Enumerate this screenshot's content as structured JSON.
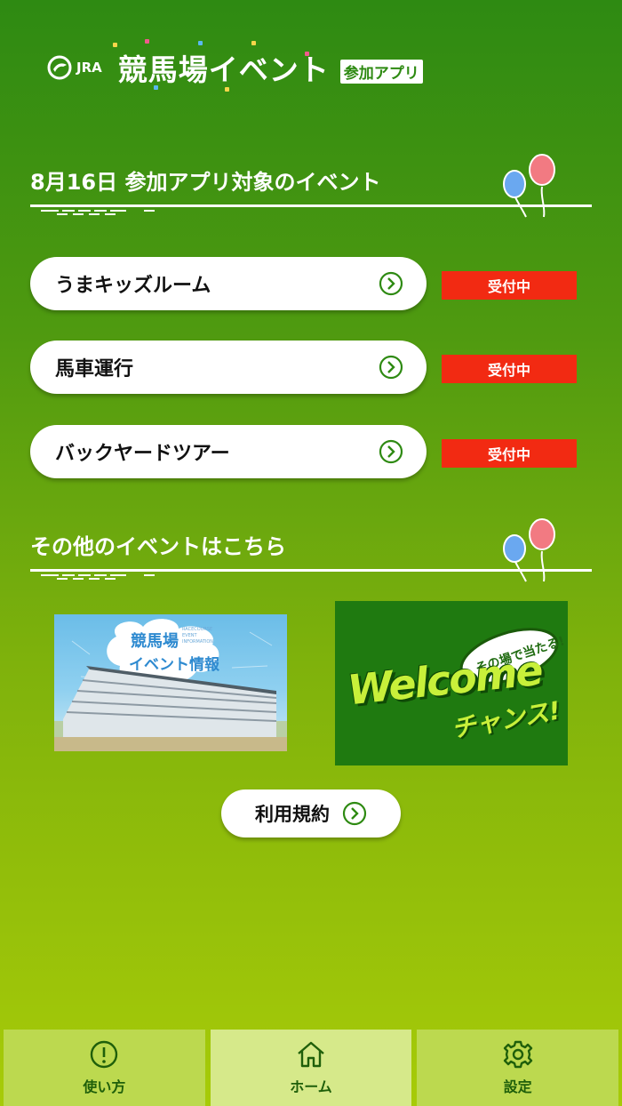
{
  "header": {
    "jra_text": "JRA",
    "app_title": "競馬場イベント",
    "app_badge": "参加アプリ"
  },
  "section_today": {
    "title": "8月16日 参加アプリ対象のイベント"
  },
  "events": [
    {
      "label": "うまキッズルーム",
      "status": "受付中"
    },
    {
      "label": "馬車運行",
      "status": "受付中"
    },
    {
      "label": "バックヤードツアー",
      "status": "受付中"
    }
  ],
  "section_other": {
    "title": "その他のイベントはこちら"
  },
  "banners": {
    "info": {
      "line1": "競馬場",
      "line2": "イベント情報",
      "sub": "RACECOURSE EVENT INFORMATION"
    },
    "welcome": {
      "top": "その場で当たる!",
      "main": "Welcome",
      "bottom": "チャンス!"
    }
  },
  "terms_button": {
    "label": "利用規約"
  },
  "tabbar": {
    "items": [
      {
        "label": "使い方",
        "icon": "exclamation-circle-icon",
        "active": false
      },
      {
        "label": "ホーム",
        "icon": "home-icon",
        "active": true
      },
      {
        "label": "設定",
        "icon": "gear-icon",
        "active": false
      }
    ]
  },
  "colors": {
    "status_red": "#f22a12",
    "accent_green": "#1f7a10",
    "white": "#ffffff"
  }
}
